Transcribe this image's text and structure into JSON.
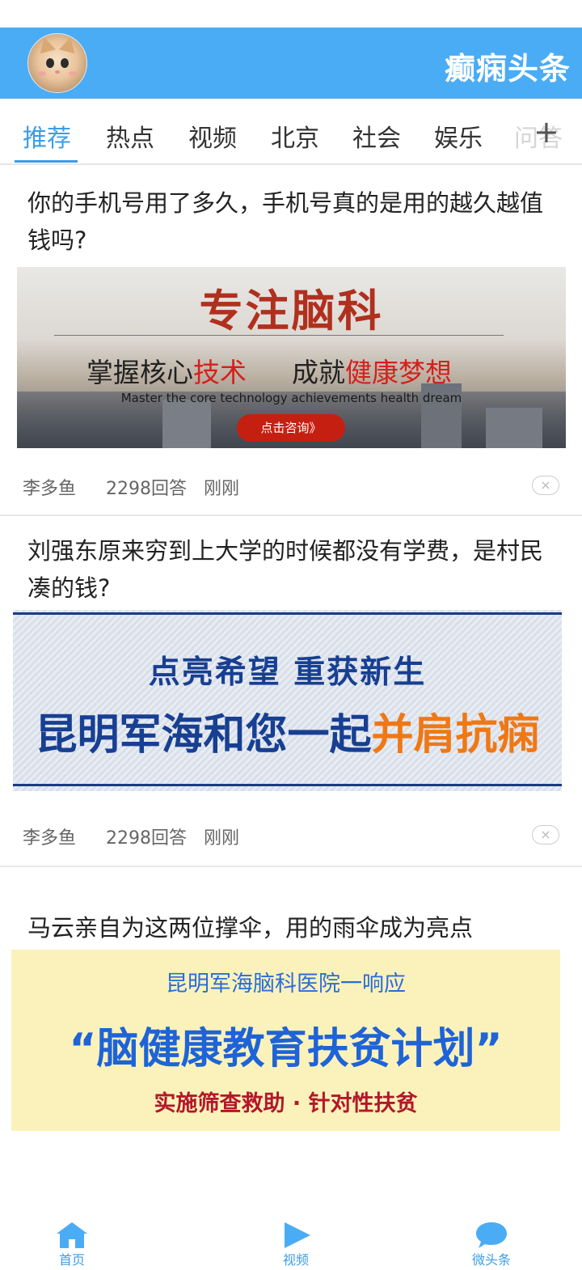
{
  "header": {
    "app_title": "癫痫头条"
  },
  "tabs": [
    {
      "label": "推荐",
      "active": true
    },
    {
      "label": "热点",
      "active": false
    },
    {
      "label": "视频",
      "active": false
    },
    {
      "label": "北京",
      "active": false
    },
    {
      "label": "社会",
      "active": false
    },
    {
      "label": "娱乐",
      "active": false
    },
    {
      "label": "问答",
      "active": false
    }
  ],
  "tab_more_label": "+",
  "articles": [
    {
      "title": "你的手机号用了多久，手机号真的是用的越久越值钱吗?",
      "author": "李多鱼",
      "answers": "2298回答",
      "time": "刚刚",
      "ad": {
        "headline": "专注脑科",
        "line_a_prefix": "掌握核心",
        "line_a_highlight": "技术",
        "line_b_prefix": "成就",
        "line_b_highlight": "健康梦想",
        "english": "Master the core technology achievements health dream",
        "cta": "点击咨询》"
      }
    },
    {
      "title": "刘强东原来穷到上大学的时候都没有学费，是村民凑的钱?",
      "author": "李多鱼",
      "answers": "2298回答",
      "time": "刚刚",
      "ad": {
        "line1": "点亮希望 重获新生",
        "line2_prefix": "昆明军海和您一起",
        "line2_highlight": "并肩抗痫"
      }
    },
    {
      "title": "马云亲自为这两位撑伞，用的雨伞成为亮点",
      "ad": {
        "line1": "昆明军海脑科医院一响应",
        "line2": "“脑健康教育扶贫计划”",
        "line3": "实施筛查救助 · 针对性扶贫"
      }
    }
  ],
  "close_symbol": "×",
  "bottom_nav": [
    {
      "label": "首页",
      "icon": "home-icon"
    },
    {
      "label": "视频",
      "icon": "play-icon"
    },
    {
      "label": "微头条",
      "icon": "chat-bubble-icon"
    }
  ],
  "colors": {
    "brand": "#4aacf4",
    "active_tab": "#3c9de6"
  }
}
